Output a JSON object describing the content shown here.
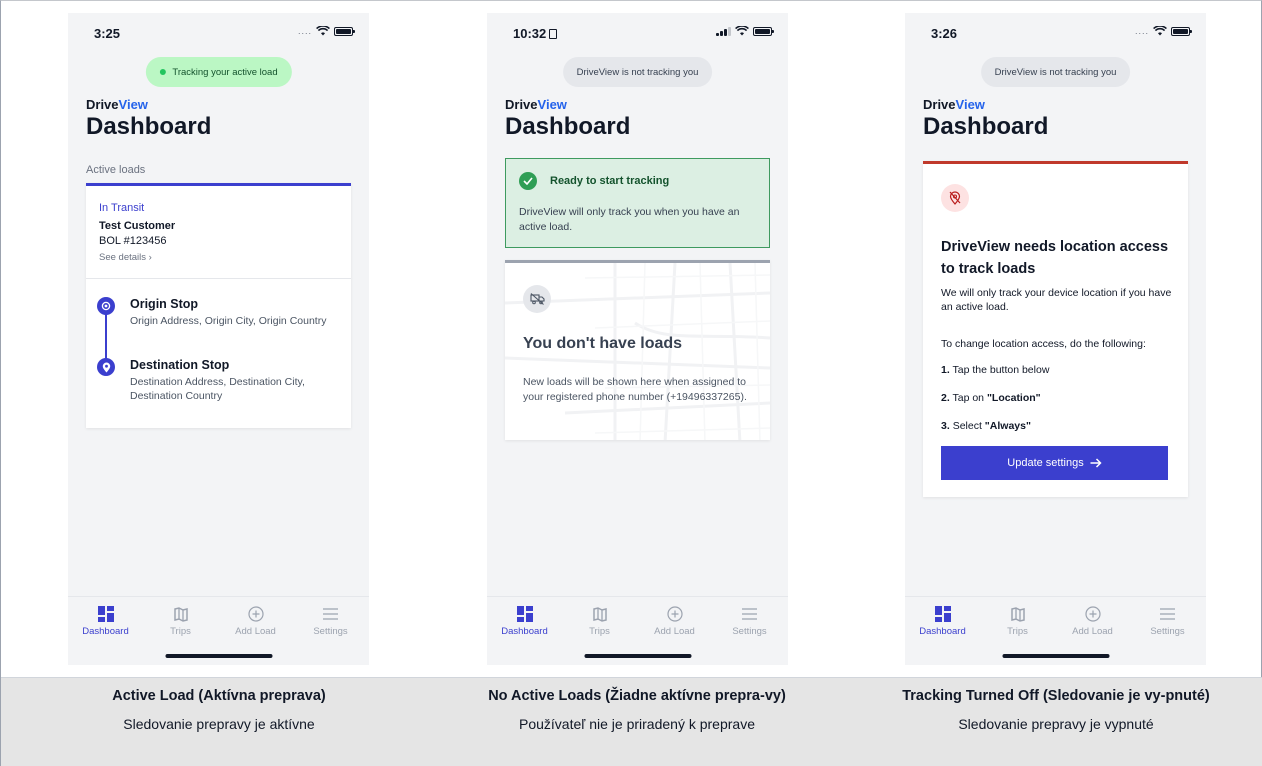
{
  "phones": [
    {
      "time": "3:25",
      "tracking_pill": "Tracking your active load",
      "brand_prefix": "Drive",
      "brand_accent": "View",
      "title": "Dashboard",
      "section_label": "Active loads",
      "load": {
        "status": "In Transit",
        "customer": "Test Customer",
        "bol": "BOL #123456",
        "details_link": "See details",
        "origin_title": "Origin Stop",
        "origin_address": "Origin Address, Origin City, Origin Country",
        "destination_title": "Destination Stop",
        "destination_address": "Destination Address, Destination City, Destination Country"
      }
    },
    {
      "time": "10:32",
      "tracking_pill": "DriveView is not tracking you",
      "brand_prefix": "Drive",
      "brand_accent": "View",
      "title": "Dashboard",
      "ready": {
        "title": "Ready to start tracking",
        "text": "DriveView will only track you when you have an active load."
      },
      "empty": {
        "title": "You don't have loads",
        "text": "New loads will be shown here when assigned to your registered phone number (+19496337265)."
      }
    },
    {
      "time": "3:26",
      "tracking_pill": "DriveView is not tracking you",
      "brand_prefix": "Drive",
      "brand_accent": "View",
      "title": "Dashboard",
      "permission": {
        "title": "DriveView needs location access to track loads",
        "intro": "We will only track your device location if you have an active load.",
        "instructions": "To change location access, do the following:",
        "step1_num": "1.",
        "step1_text": "Tap the button below",
        "step2_num": "2.",
        "step2_pre": "Tap on ",
        "step2_bold": "\"Location\"",
        "step3_num": "3.",
        "step3_pre": "Select ",
        "step3_bold": "\"Always\"",
        "button": "Update settings"
      }
    }
  ],
  "tabs": {
    "dashboard": "Dashboard",
    "trips": "Trips",
    "add_load": "Add Load",
    "settings": "Settings"
  },
  "captions": [
    {
      "title": "Active Load (Aktívna preprava)",
      "subtitle": "Sledovanie prepravy je aktívne"
    },
    {
      "title": "No Active Loads (Žiadne aktívne prepra-vy)",
      "subtitle": "Používateľ nie je priradený k preprave"
    },
    {
      "title": "Tracking Turned Off (Sledovanie je vy-pnuté)",
      "subtitle": "Sledovanie prepravy je vypnuté"
    }
  ],
  "colors": {
    "accent": "#3b3fce",
    "brand_view": "#2563eb",
    "success_bg": "#dcefe3",
    "success_border": "#3e9a5f",
    "danger_top": "#c0392b",
    "pill_on": "#bbf7c4",
    "pill_off": "#e5e7eb"
  },
  "icons": {
    "active_tab": "dashboard-grid-icon",
    "trips": "map-icon",
    "add_load": "plus-circle-icon",
    "settings": "menu-icon",
    "origin": "target-icon",
    "destination": "map-pin-icon",
    "ready": "check-circle-icon",
    "empty": "truck-off-icon",
    "permission": "location-off-icon",
    "button": "arrow-right-icon"
  }
}
